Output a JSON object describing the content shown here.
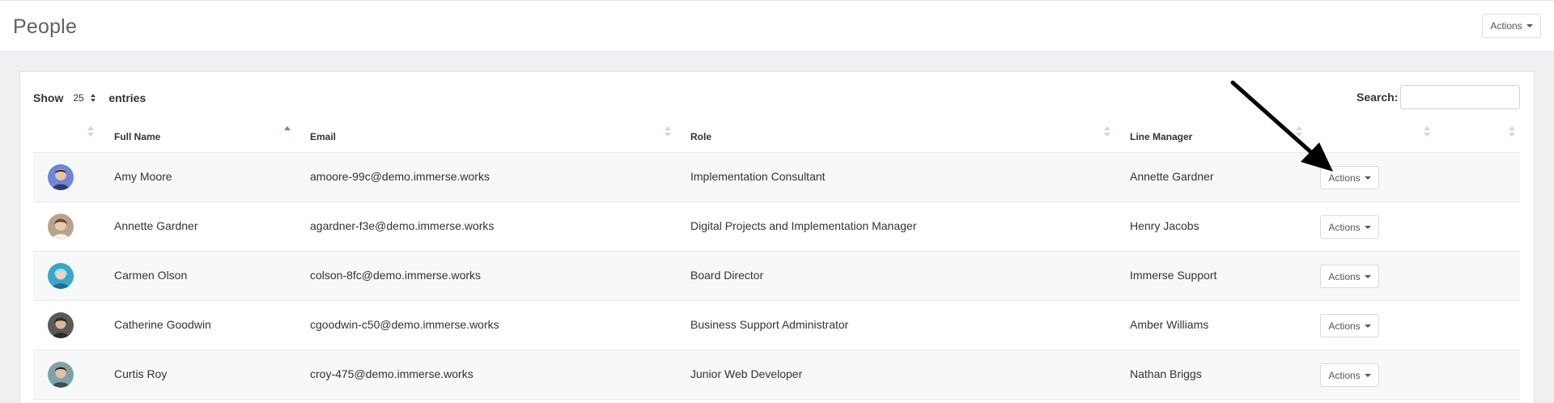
{
  "header": {
    "title": "People",
    "actions_label": "Actions"
  },
  "table_controls": {
    "show_label": "Show",
    "entries_value": "25",
    "entries_label": "entries",
    "search_label": "Search:",
    "search_value": ""
  },
  "columns": [
    "Full Name",
    "Email",
    "Role",
    "Line Manager"
  ],
  "sort": {
    "column": "Full Name",
    "direction": "ascending"
  },
  "rows": [
    {
      "name": "Amy Moore",
      "email": "amoore-99c@demo.immerse.works",
      "role": "Implementation Consultant",
      "manager": "Annette Gardner",
      "actions": "Actions",
      "avatar_color": "#6f86d6"
    },
    {
      "name": "Annette Gardner",
      "email": "agardner-f3e@demo.immerse.works",
      "role": "Digital Projects and Implementation Manager",
      "manager": "Henry Jacobs",
      "actions": "Actions",
      "avatar_color": "#b7a48d"
    },
    {
      "name": "Carmen Olson",
      "email": "colson-8fc@demo.immerse.works",
      "role": "Board Director",
      "manager": "Immerse Support",
      "actions": "Actions",
      "avatar_color": "#3aa7c7"
    },
    {
      "name": "Catherine Goodwin",
      "email": "cgoodwin-c50@demo.immerse.works",
      "role": "Business Support Administrator",
      "manager": "Amber Williams",
      "actions": "Actions",
      "avatar_color": "#5c5a57"
    },
    {
      "name": "Curtis Roy",
      "email": "croy-475@demo.immerse.works",
      "role": "Junior Web Developer",
      "manager": "Nathan Briggs",
      "actions": "Actions",
      "avatar_color": "#7fa2a8"
    }
  ],
  "annotation": {
    "arrow_color": "#000000",
    "points_to": "Actions button, first row"
  },
  "colors": {
    "sort_active": "#6f7ad9",
    "row_stripe": "#f7f8f9",
    "page_bg": "#eef0f2"
  }
}
